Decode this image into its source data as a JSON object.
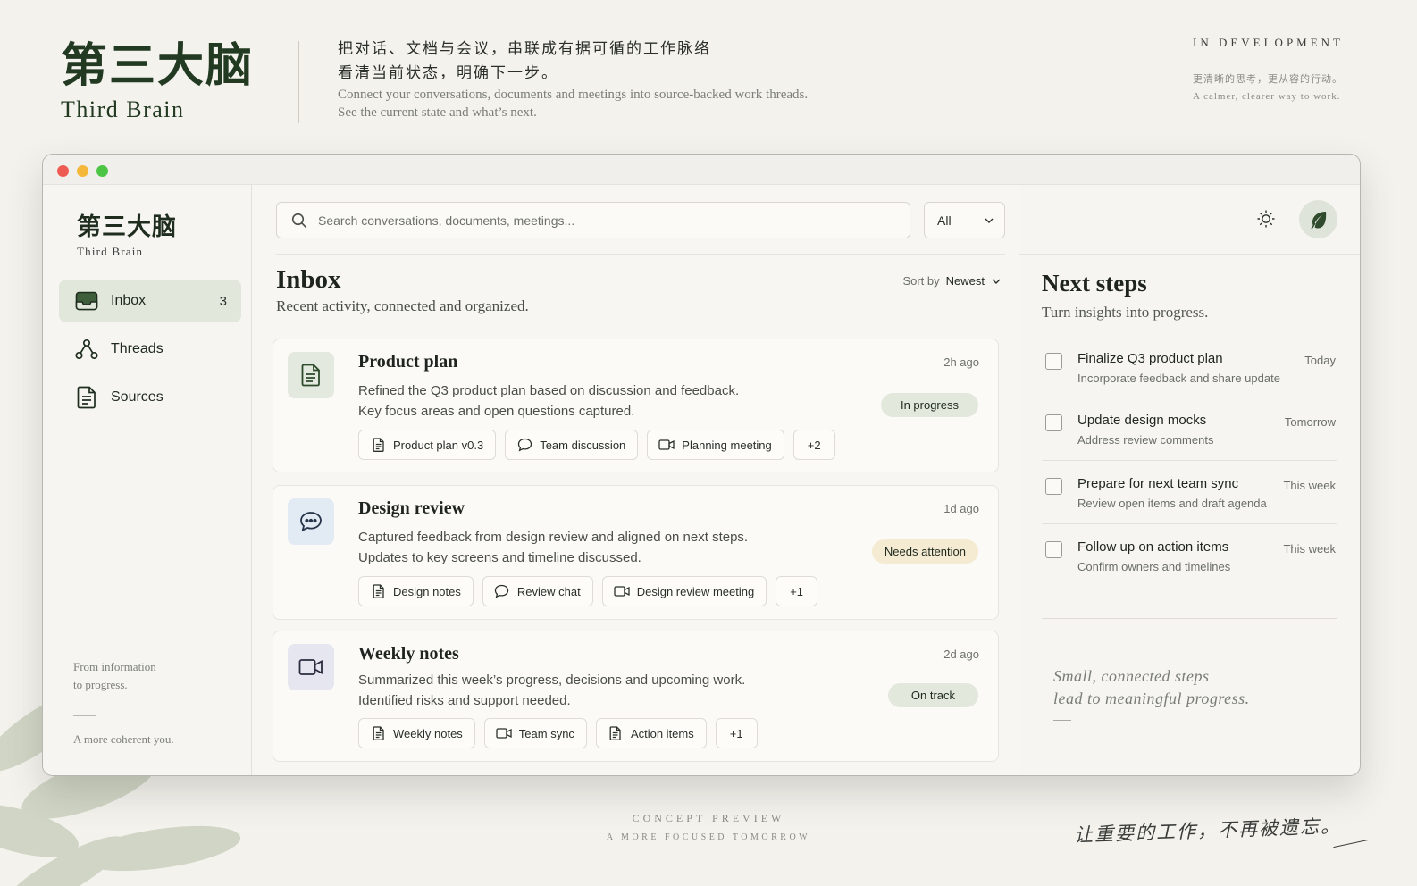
{
  "hero": {
    "brand_cn": "第三大脑",
    "brand_en": "Third Brain",
    "tagline_cn_1": "把对话、文档与会议，串联成有据可循的工作脉络",
    "tagline_cn_2": "看清当前状态，明确下一步。",
    "tagline_en_1": "Connect your conversations, documents and meetings into source-backed work threads.",
    "tagline_en_2": "See the current state and what’s next.",
    "status_label": "IN DEVELOPMENT",
    "status_cn": "更清晰的思考，更从容的行动。",
    "status_en": "A calmer, clearer way to work."
  },
  "sidebar": {
    "brand_cn": "第三大脑",
    "brand_en": "Third Brain",
    "items": [
      {
        "label": "Inbox",
        "count": "3",
        "icon": "inbox-icon",
        "active": true
      },
      {
        "label": "Threads",
        "icon": "threads-icon"
      },
      {
        "label": "Sources",
        "icon": "document-icon"
      }
    ],
    "footer_1": "From information",
    "footer_2": "to progress.",
    "footer_3": "A more coherent you."
  },
  "main": {
    "search_placeholder": "Search conversations, documents, meetings...",
    "filter_value": "All",
    "title": "Inbox",
    "subtitle": "Recent activity, connected and organized.",
    "sort_label": "Sort by",
    "sort_value": "Newest",
    "cards": [
      {
        "title": "Product plan",
        "time": "2h ago",
        "desc_1": "Refined the Q3 product plan based on discussion and feedback.",
        "desc_2": "Key focus areas and open questions captured.",
        "status": "In progress",
        "icon": "document-icon",
        "chips": [
          {
            "label": "Product plan v0.3",
            "icon": "document-icon"
          },
          {
            "label": "Team discussion",
            "icon": "chat-icon"
          },
          {
            "label": "Planning meeting",
            "icon": "video-icon"
          },
          {
            "label": "+2"
          }
        ]
      },
      {
        "title": "Design review",
        "time": "1d ago",
        "desc_1": "Captured feedback from design review and aligned on next steps.",
        "desc_2": "Updates to key screens and timeline discussed.",
        "status": "Needs attention",
        "icon": "chat-icon",
        "chips": [
          {
            "label": "Design notes",
            "icon": "document-icon"
          },
          {
            "label": "Review chat",
            "icon": "chat-icon"
          },
          {
            "label": "Design review meeting",
            "icon": "video-icon"
          },
          {
            "label": "+1"
          }
        ]
      },
      {
        "title": "Weekly notes",
        "time": "2d ago",
        "desc_1": "Summarized this week’s progress, decisions and upcoming work.",
        "desc_2": "Identified risks and support needed.",
        "status": "On track",
        "icon": "video-icon",
        "chips": [
          {
            "label": "Weekly notes",
            "icon": "document-icon"
          },
          {
            "label": "Team sync",
            "icon": "video-icon"
          },
          {
            "label": "Action items",
            "icon": "document-icon"
          },
          {
            "label": "+1"
          }
        ]
      }
    ]
  },
  "next_steps": {
    "title": "Next steps",
    "subtitle": "Turn insights into progress.",
    "tasks": [
      {
        "title": "Finalize Q3 product plan",
        "sub": "Incorporate feedback and share update",
        "due": "Today"
      },
      {
        "title": "Update design mocks",
        "sub": "Address review comments",
        "due": "Tomorrow"
      },
      {
        "title": "Prepare for next team sync",
        "sub": "Review open items and draft agenda",
        "due": "This week"
      },
      {
        "title": "Follow up on action items",
        "sub": "Confirm owners and timelines",
        "due": "This week"
      }
    ],
    "quote_1": "Small, connected steps",
    "quote_2": "lead to meaningful progress."
  },
  "footer": {
    "line_1": "CONCEPT PREVIEW",
    "line_2": "A MORE FOCUSED TOMORROW",
    "cn": "让重要的工作，不再被遗忘。"
  },
  "colors": {
    "accent_green": "#223a22",
    "active_nav_bg": "#e2e7dc",
    "badge_green": "#e2e8dc",
    "badge_amber": "#f5ead2",
    "icon_green_bg": "#e3e9de",
    "icon_blue_bg": "#e2ebf3",
    "icon_violet_bg": "#e6e6f0"
  }
}
